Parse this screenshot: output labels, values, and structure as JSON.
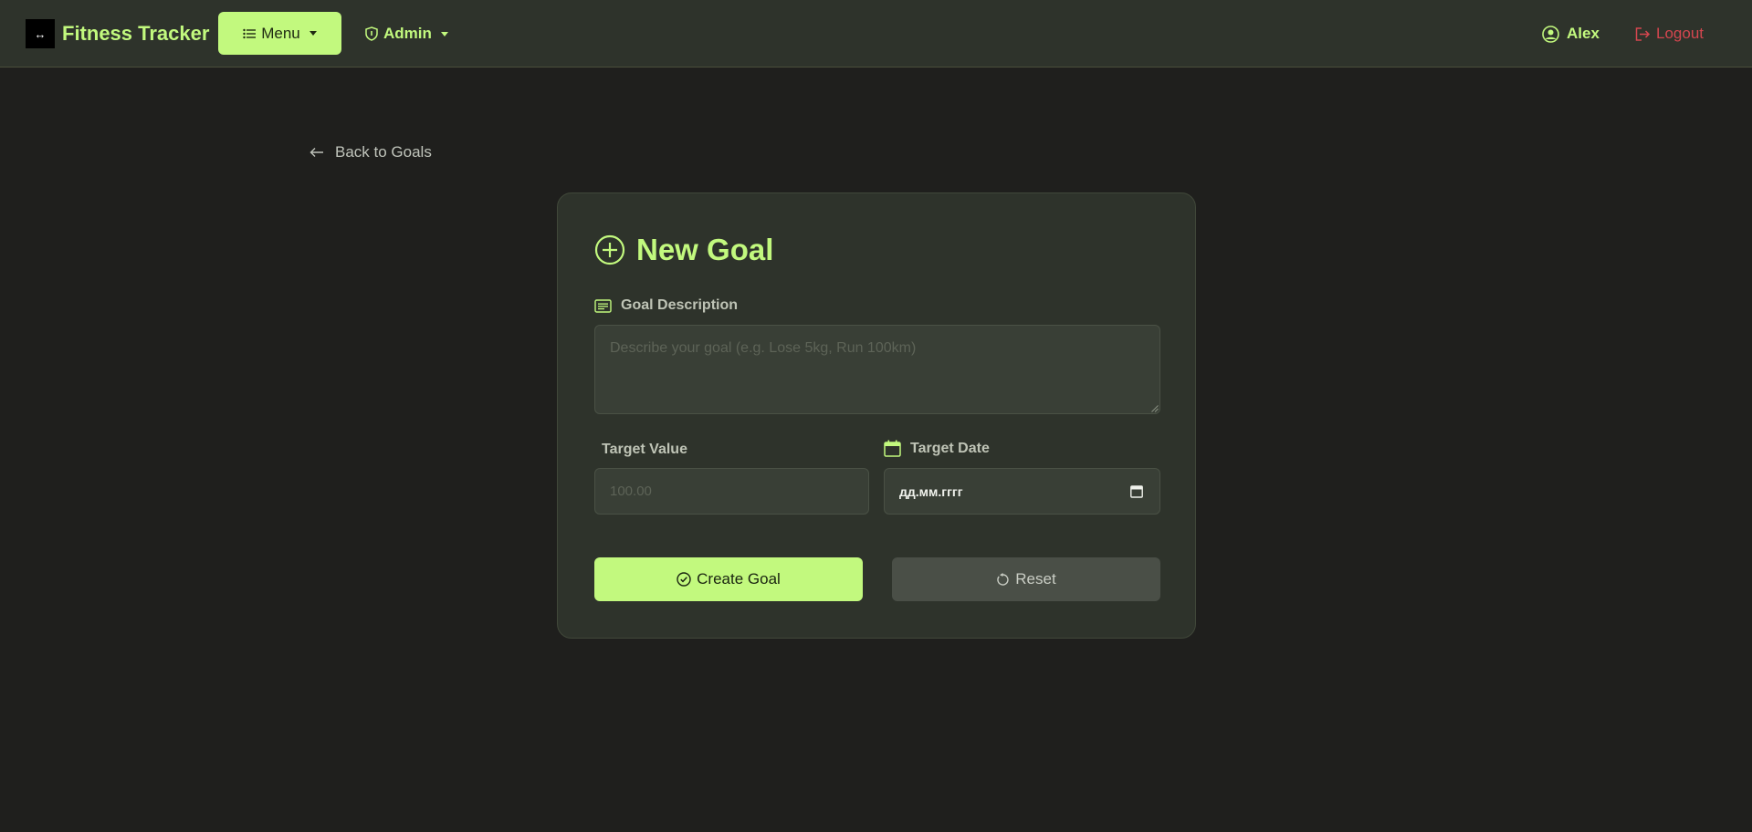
{
  "navbar": {
    "brand_logo_glyph": "↔",
    "brand_name": "Fitness Tracker",
    "menu_label": "Menu",
    "admin_label": "Admin",
    "user_name": "Alex",
    "logout_label": "Logout"
  },
  "back_link": {
    "label": "Back to Goals"
  },
  "form": {
    "title": "New Goal",
    "description_label": "Goal Description",
    "description_placeholder": "Describe your goal (e.g. Lose 5kg, Run 100km)",
    "description_value": "",
    "target_value_label": "Target Value",
    "target_value_placeholder": "100.00",
    "target_value_value": "",
    "target_date_label": "Target Date",
    "target_date_value": "дд.мм.гггг",
    "create_label": "Create Goal",
    "reset_label": "Reset"
  },
  "icons": {
    "brand": "dumbbell-icon",
    "menu": "list-icon",
    "admin": "shield-icon",
    "user": "user-circle-icon",
    "logout": "logout-icon",
    "back": "arrow-left-icon",
    "title": "plus-circle-icon",
    "description": "card-text-icon",
    "date": "calendar-icon",
    "create": "check-circle-icon",
    "reset": "reset-icon"
  },
  "colors": {
    "background": "#1f1f1d",
    "surface": "#2e332b",
    "accent": "#c2f97e",
    "danger": "#d4464f",
    "input_bg": "#393f36",
    "secondary_button": "#4a4f47"
  }
}
